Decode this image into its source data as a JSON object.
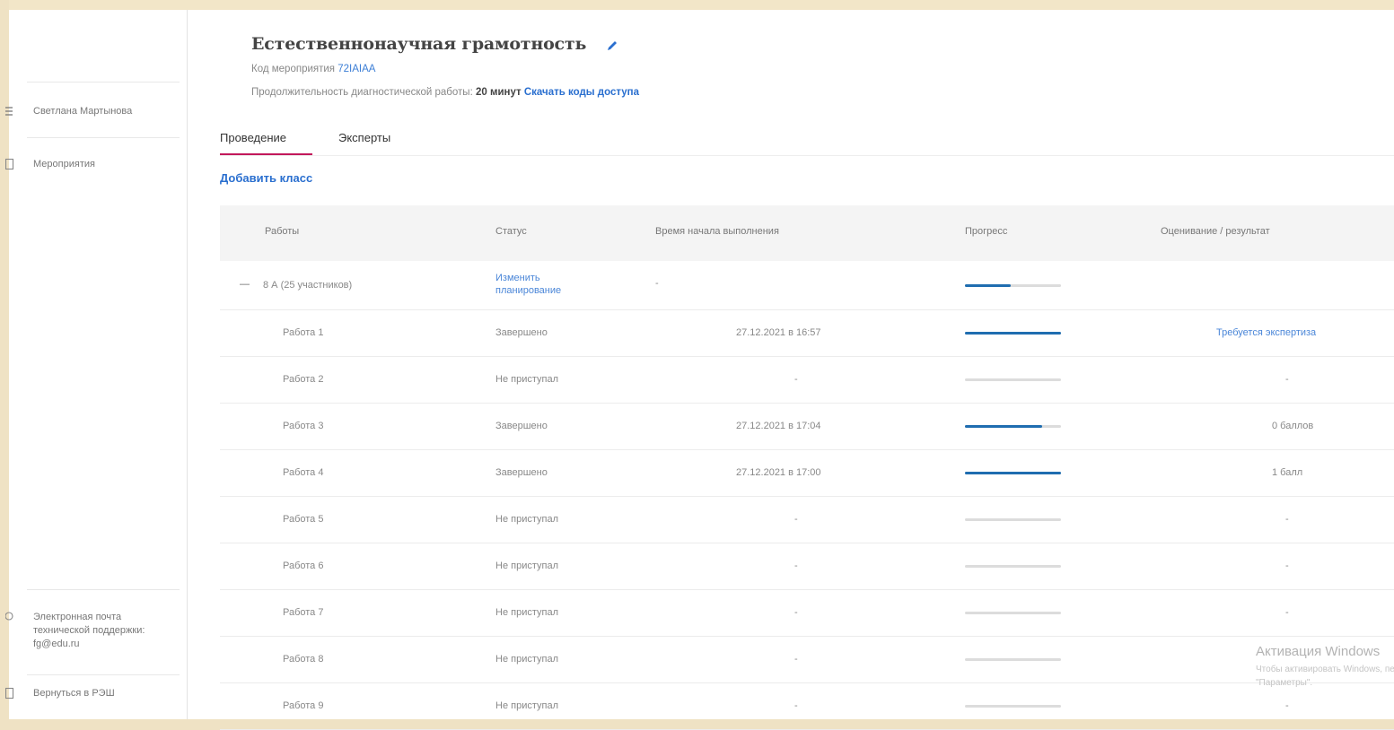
{
  "sidebar": {
    "user_name": "Светлана Мартынова",
    "events_label": "Мероприятия",
    "support_label": "Электронная почта технической поддержки: fg@edu.ru",
    "back_label": "Вернуться в РЭШ"
  },
  "header": {
    "title": "Естественнонаучная грамотность",
    "event_code_label": "Код мероприятия",
    "event_code": "72IAIAA",
    "duration_label": "Продолжительность диагностической работы:",
    "duration_value": "20 минут",
    "download_codes": "Скачать коды доступа"
  },
  "tabs": [
    {
      "label": "Проведение",
      "active": true
    },
    {
      "label": "Эксперты",
      "active": false
    }
  ],
  "add_class_label": "Добавить класс",
  "table": {
    "columns": [
      "Работы",
      "Статус",
      "Время начала выполнения",
      "Прогресс",
      "Оценивание / результат"
    ],
    "group": {
      "toggle": "—",
      "name": "8 А (25 участников)",
      "status": "Изменить планирование",
      "start": "-",
      "progress": 0.48
    },
    "rows": [
      {
        "name": "Работа 1",
        "status": "Завершено",
        "start": "27.12.2021 в 16:57",
        "progress": 1.0,
        "result": "Требуется экспертиза",
        "result_link": true
      },
      {
        "name": "Работа 2",
        "status": "Не приступал",
        "start": "-",
        "progress": 0,
        "result": "-",
        "result_link": false
      },
      {
        "name": "Работа 3",
        "status": "Завершено",
        "start": "27.12.2021 в 17:04",
        "progress": 0.8,
        "result": "0 баллов",
        "result_link": false
      },
      {
        "name": "Работа 4",
        "status": "Завершено",
        "start": "27.12.2021 в 17:00",
        "progress": 1.0,
        "result": "1 балл",
        "result_link": false
      },
      {
        "name": "Работа 5",
        "status": "Не приступал",
        "start": "-",
        "progress": 0,
        "result": "-",
        "result_link": false
      },
      {
        "name": "Работа 6",
        "status": "Не приступал",
        "start": "-",
        "progress": 0,
        "result": "-",
        "result_link": false
      },
      {
        "name": "Работа 7",
        "status": "Не приступал",
        "start": "-",
        "progress": 0,
        "result": "-",
        "result_link": false
      },
      {
        "name": "Работа 8",
        "status": "Не приступал",
        "start": "-",
        "progress": 0,
        "result": "",
        "result_link": false
      },
      {
        "name": "Работа 9",
        "status": "Не приступал",
        "start": "-",
        "progress": 0,
        "result": "-",
        "result_link": false
      }
    ]
  },
  "watermark": {
    "title": "Активация Windows",
    "line1": "Чтобы активировать Windows, перейдите в разде",
    "line2": "\"Параметры\"."
  },
  "colors": {
    "accent": "#2a6fcf",
    "progress": "#1f6db0",
    "tab_underline": "#c2185b"
  }
}
